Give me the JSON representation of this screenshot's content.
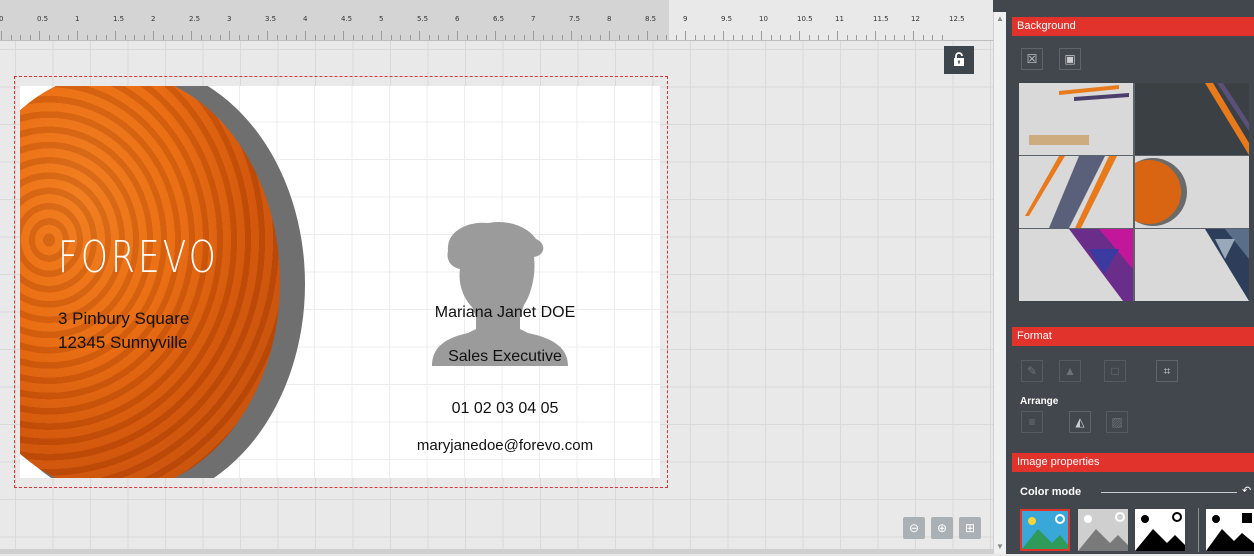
{
  "ruler": {
    "labels": [
      "0",
      "0.5",
      "1",
      "1.5",
      "2",
      "2.5",
      "3",
      "3.5",
      "4",
      "4.5",
      "5",
      "5.5",
      "6",
      "6.5",
      "7",
      "7.5",
      "8",
      "8.5",
      "9",
      "9.5",
      "10",
      "10.5",
      "11",
      "11.5",
      "12",
      "12.5"
    ]
  },
  "card": {
    "logo": "FOREVO",
    "address_line1": "3 Pinbury Square",
    "address_line2": "12345 Sunnyville",
    "name": "Mariana Janet DOE",
    "title": "Sales Executive",
    "phone": "01 02 03 04 05",
    "email": "maryjanedoe@forevo.com"
  },
  "panel": {
    "background_header": "Background",
    "format_header": "Format",
    "arrange_label": "Arrange",
    "image_properties_header": "Image properties",
    "color_mode_label": "Color mode"
  },
  "colors": {
    "accent": "#e1322c",
    "panel_bg": "#41474c",
    "orange": "#e86a10"
  },
  "icons": [
    "lock-icon",
    "zoom-out-icon",
    "zoom-in-icon",
    "zoom-fit-icon",
    "remove-background-icon",
    "background-preview-icon",
    "paint-bucket-icon",
    "fill-color-icon",
    "border-color-icon",
    "crop-icon",
    "align-icon",
    "flip-icon",
    "layer-order-icon",
    "reset-icon"
  ]
}
